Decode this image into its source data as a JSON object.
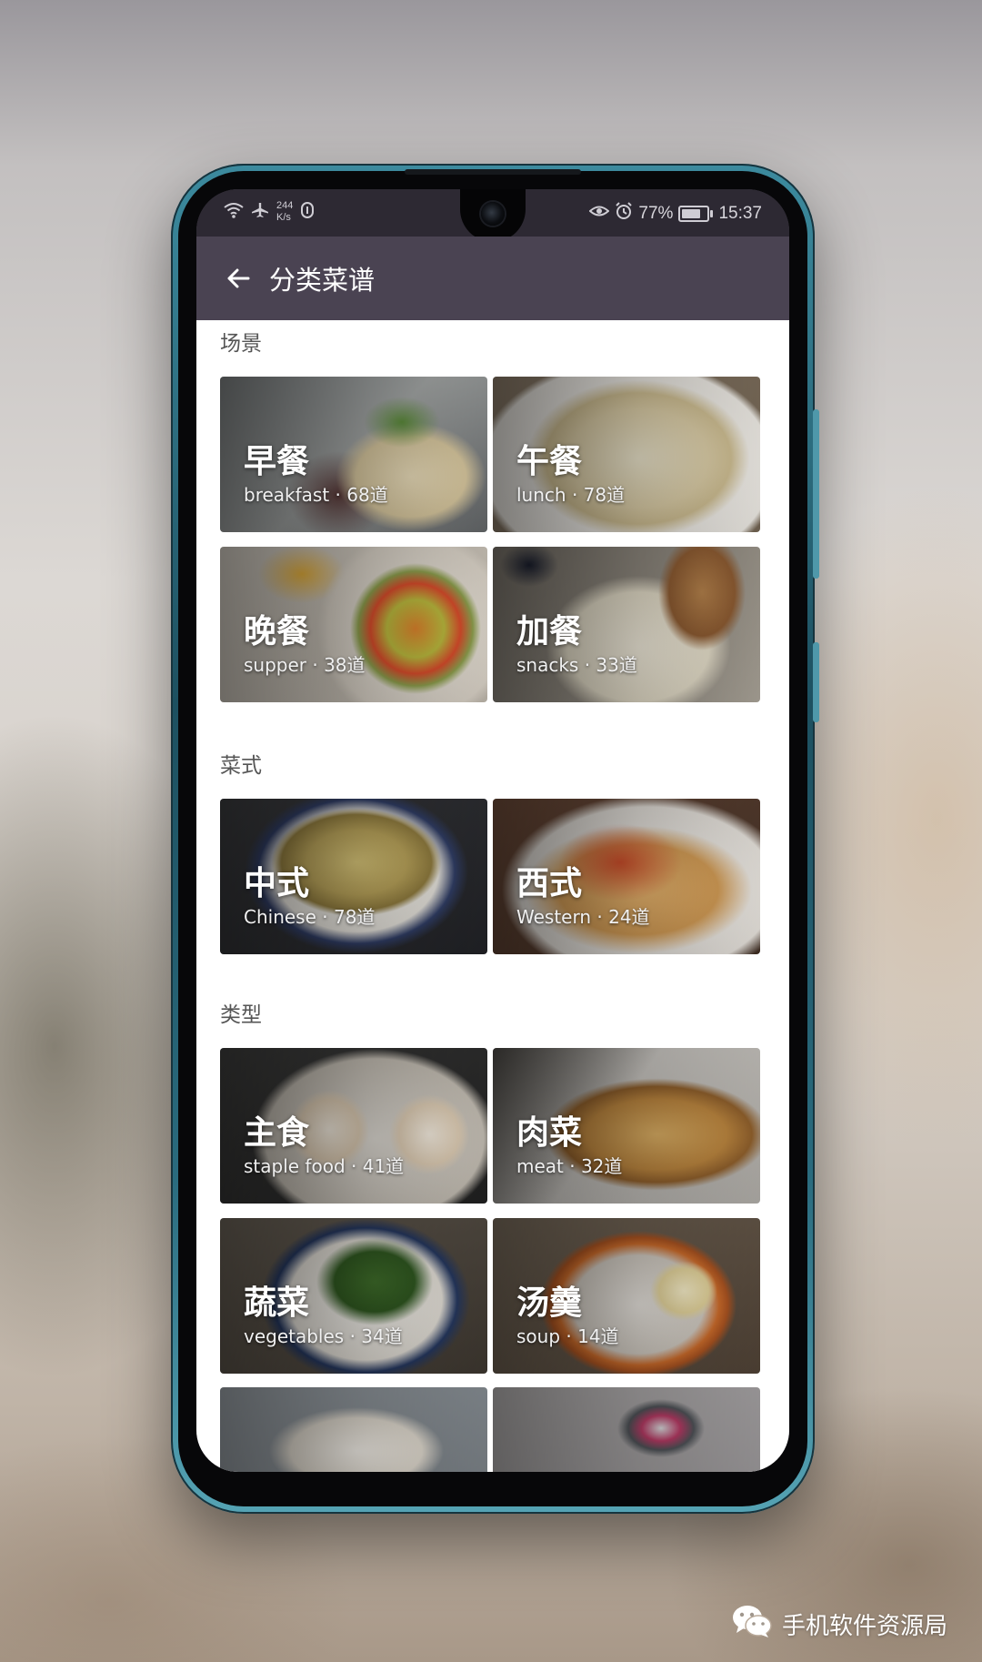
{
  "status_bar": {
    "net_speed_value": "244",
    "net_speed_unit": "K/s",
    "battery_text": "77%",
    "battery_level": 0.77,
    "time": "15:37"
  },
  "app_bar": {
    "title": "分类菜谱"
  },
  "sections": [
    {
      "header": "场景",
      "cards": [
        {
          "title": "早餐",
          "subtitle": "breakfast · 68道"
        },
        {
          "title": "午餐",
          "subtitle": "lunch · 78道"
        },
        {
          "title": "晚餐",
          "subtitle": "supper · 38道"
        },
        {
          "title": "加餐",
          "subtitle": "snacks · 33道"
        }
      ]
    },
    {
      "header": "菜式",
      "cards": [
        {
          "title": "中式",
          "subtitle": "Chinese · 78道"
        },
        {
          "title": "西式",
          "subtitle": "Western · 24道"
        }
      ]
    },
    {
      "header": "类型",
      "cards": [
        {
          "title": "主食",
          "subtitle": "staple food · 41道"
        },
        {
          "title": "肉菜",
          "subtitle": "meat · 32道"
        },
        {
          "title": "蔬菜",
          "subtitle": "vegetables · 34道"
        },
        {
          "title": "汤羹",
          "subtitle": "soup · 14道"
        }
      ]
    }
  ],
  "watermark": {
    "text": "手机软件资源局"
  },
  "colors": {
    "app_bar": "#4a4352",
    "status_bar": "#2d2933",
    "content_bg": "#ffffff",
    "phone_frame": "#2a6b7e"
  }
}
